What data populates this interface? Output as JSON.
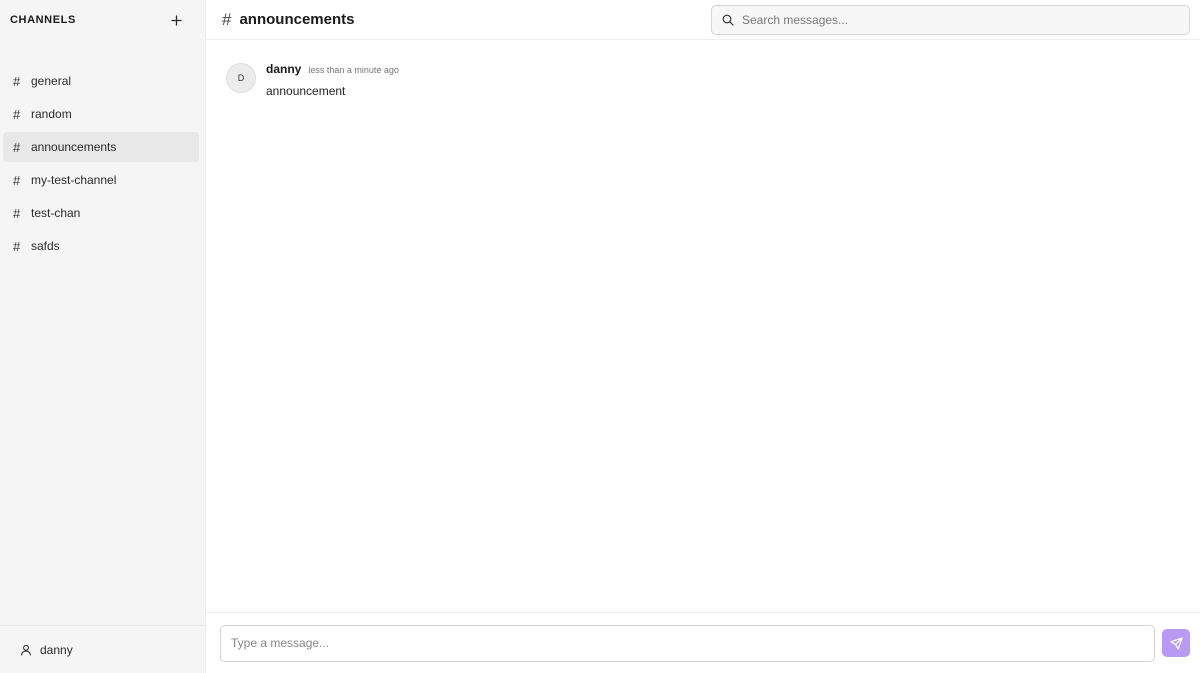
{
  "sidebar": {
    "title": "CHANNELS",
    "add_icon": "plus-icon",
    "channels": [
      {
        "label": "general",
        "active": false
      },
      {
        "label": "random",
        "active": false
      },
      {
        "label": "announcements",
        "active": true
      },
      {
        "label": "my-test-channel",
        "active": false
      },
      {
        "label": "test-chan",
        "active": false
      },
      {
        "label": "safds",
        "active": false
      }
    ],
    "user": {
      "name": "danny",
      "icon": "user-icon"
    }
  },
  "header": {
    "channel_name": "announcements",
    "search": {
      "placeholder": "Search messages...",
      "value": "",
      "icon": "search-icon"
    }
  },
  "messages": [
    {
      "avatar_initial": "D",
      "author": "danny",
      "time": "less than a minute ago",
      "text": "announcement"
    }
  ],
  "composer": {
    "placeholder": "Type a message...",
    "value": "",
    "send_icon": "send-icon"
  },
  "colors": {
    "accent": "#b89af5",
    "sidebar_bg": "#f5f5f5",
    "active_item_bg": "#e8e8e8"
  }
}
